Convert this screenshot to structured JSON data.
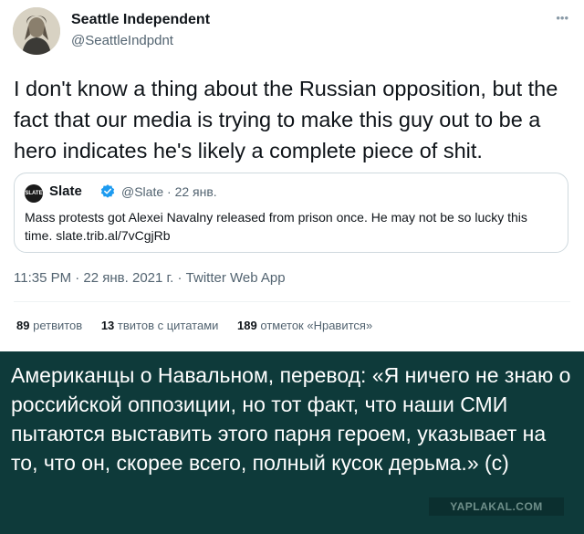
{
  "tweet": {
    "author": {
      "name": "Seattle Independent",
      "handle": "@SeattleIndpdnt"
    },
    "more_icon": "•••",
    "text": "I don't know a thing about the Russian opposition, but the fact that our media is trying to make this guy out to be a hero indicates he's likely a complete piece of shit.",
    "quoted": {
      "avatar_text": "SLATE",
      "name": "Slate",
      "handle_time": "@Slate · 22 янв.",
      "text": "Mass protests got Alexei Navalny released from prison once. He may not be so lucky this time. slate.trib.al/7vCgjRb"
    },
    "meta": "11:35 PM · 22 янв. 2021 г. · Twitter Web App",
    "stats": {
      "retweets_count": "89",
      "retweets_label": "ретвитов",
      "quotes_count": "13",
      "quotes_label": "твитов с цитатами",
      "likes_count": "189",
      "likes_label": "отметок «Нравится»"
    }
  },
  "caption": {
    "text": "Американцы о Навальном, перевод: «Я ничего не знаю о российской оппозиции, но тот факт, что наши СМИ пытаются выставить этого парня героем, указывает на то, что он, скорее всего, полный кусок дерьма.» (с)",
    "watermark": "YAPLAKAL.COM"
  },
  "colors": {
    "caption_bg": "#0e3a3a",
    "verified": "#1d9bf0",
    "secondary_text": "#536471"
  },
  "icons": [
    "more-icon",
    "verified-badge-icon"
  ]
}
